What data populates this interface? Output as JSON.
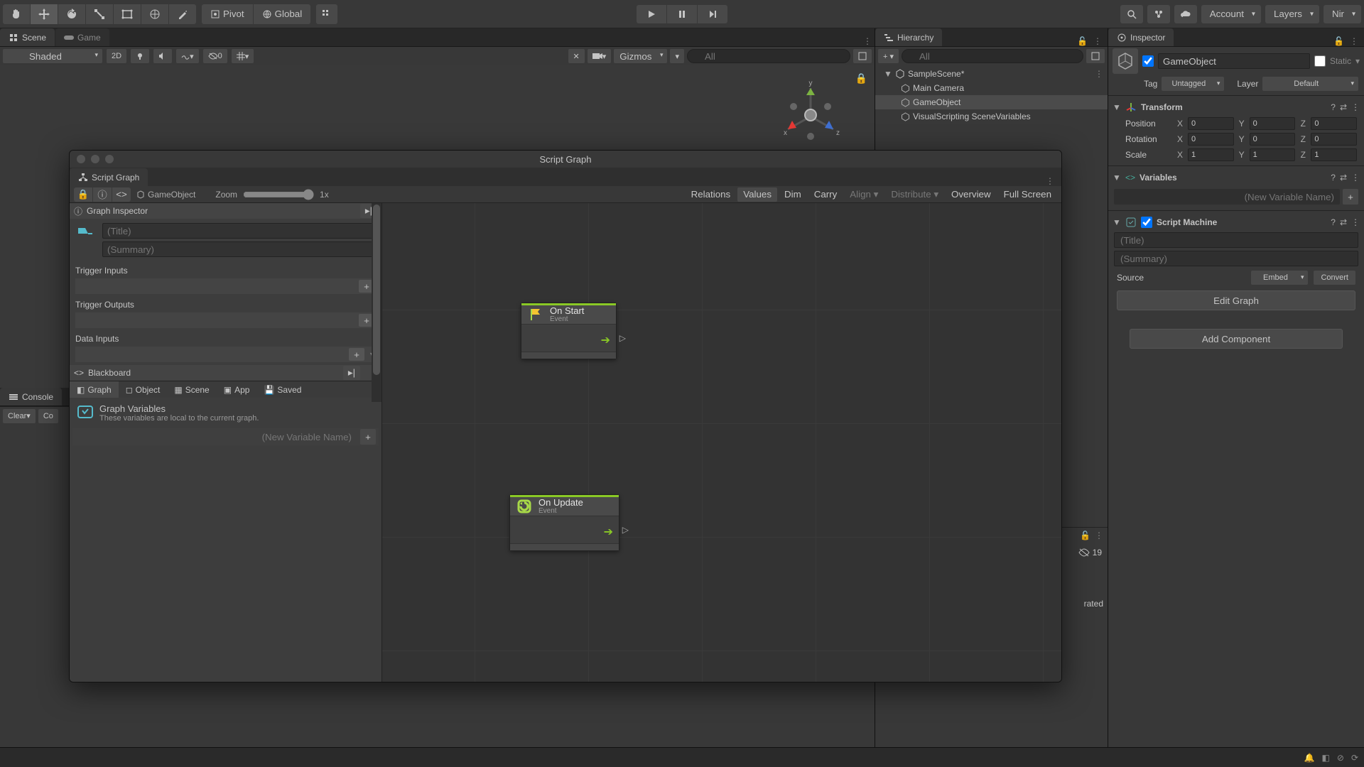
{
  "toolbar": {
    "pivot_label": "Pivot",
    "global_label": "Global",
    "account_label": "Account",
    "layers_label": "Layers",
    "layout_label": "Nir"
  },
  "tabs": {
    "scene": "Scene",
    "game": "Game",
    "hierarchy": "Hierarchy",
    "inspector": "Inspector",
    "console": "Console"
  },
  "scene_toolbar": {
    "shaded": "Shaded",
    "mode_2d": "2D",
    "hidden_zero": "0",
    "gizmos": "Gizmos",
    "search_placeholder": "All"
  },
  "axis": {
    "x": "x",
    "y": "y",
    "z": "z"
  },
  "hierarchy": {
    "search_placeholder": "All",
    "scene_name": "SampleScene*",
    "items": [
      "Main Camera",
      "GameObject",
      "VisualScripting SceneVariables"
    ]
  },
  "inspector": {
    "object_name": "GameObject",
    "static_label": "Static",
    "tag_label": "Tag",
    "tag_value": "Untagged",
    "layer_label": "Layer",
    "layer_value": "Default",
    "transform": {
      "title": "Transform",
      "position_label": "Position",
      "rotation_label": "Rotation",
      "scale_label": "Scale",
      "x": "X",
      "y": "Y",
      "z": "Z",
      "pos": {
        "x": "0",
        "y": "0",
        "z": "0"
      },
      "rot": {
        "x": "0",
        "y": "0",
        "z": "0"
      },
      "scl": {
        "x": "1",
        "y": "1",
        "z": "1"
      }
    },
    "variables": {
      "title": "Variables",
      "new_placeholder": "(New Variable Name)"
    },
    "script_machine": {
      "title": "Script Machine",
      "title_placeholder": "(Title)",
      "summary_placeholder": "(Summary)",
      "source_label": "Source",
      "source_value": "Embed",
      "convert_label": "Convert",
      "edit_graph_label": "Edit Graph"
    },
    "add_component": "Add Component"
  },
  "console": {
    "clear_label": "Clear",
    "co_label": "Co"
  },
  "script_graph": {
    "window_title": "Script Graph",
    "tab_label": "Script Graph",
    "breadcrumb": "GameObject",
    "zoom_label": "Zoom",
    "zoom_value": "1x",
    "toolbar": {
      "relations": "Relations",
      "values": "Values",
      "dim": "Dim",
      "carry": "Carry",
      "align": "Align",
      "distribute": "Distribute",
      "overview": "Overview",
      "fullscreen": "Full Screen"
    },
    "graph_inspector": {
      "title": "Graph Inspector",
      "title_placeholder": "(Title)",
      "summary_placeholder": "(Summary)",
      "trigger_inputs": "Trigger Inputs",
      "trigger_outputs": "Trigger Outputs",
      "data_inputs": "Data Inputs"
    },
    "blackboard": {
      "title": "Blackboard",
      "tabs": [
        "Graph",
        "Object",
        "Scene",
        "App",
        "Saved"
      ],
      "graph_vars_title": "Graph Variables",
      "graph_vars_sub": "These variables are local to the current graph.",
      "new_placeholder": "(New Variable Name)"
    },
    "nodes": {
      "on_start": {
        "title": "On Start",
        "subtitle": "Event"
      },
      "on_update": {
        "title": "On Update",
        "subtitle": "Event"
      }
    }
  },
  "hidden_count": "19",
  "truncated_text": "rated"
}
